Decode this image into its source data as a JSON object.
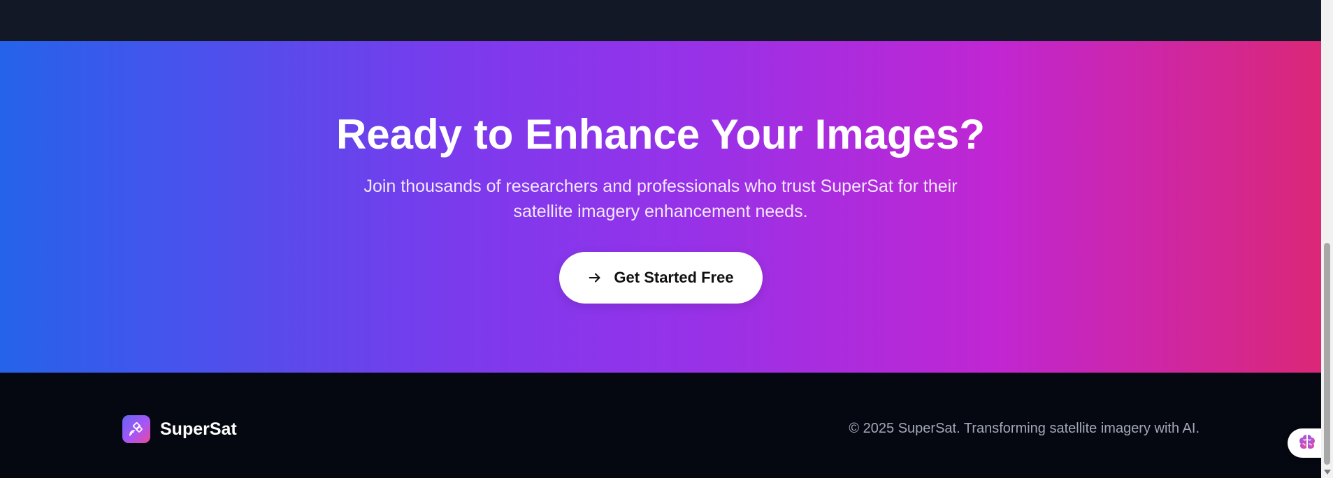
{
  "cta": {
    "title": "Ready to Enhance Your Images?",
    "subtitle": "Join thousands of researchers and professionals who trust SuperSat for their satellite imagery enhancement needs.",
    "button_label": "Get Started Free",
    "button_icon": "arrow-right-icon",
    "gradient_colors": [
      "#2563eb",
      "#7c3aed",
      "#9333ea",
      "#c026d3",
      "#db2777"
    ]
  },
  "footer": {
    "brand_name": "SuperSat",
    "brand_icon": "satellite-icon",
    "copyright": "© 2025 SuperSat. Transforming satellite imagery with AI."
  },
  "widget": {
    "icon": "brain-icon"
  },
  "colors": {
    "top_strip": "#121826",
    "footer_bg": "#050811",
    "text_white": "#ffffff",
    "copyright_text": "#a3a8b6"
  }
}
